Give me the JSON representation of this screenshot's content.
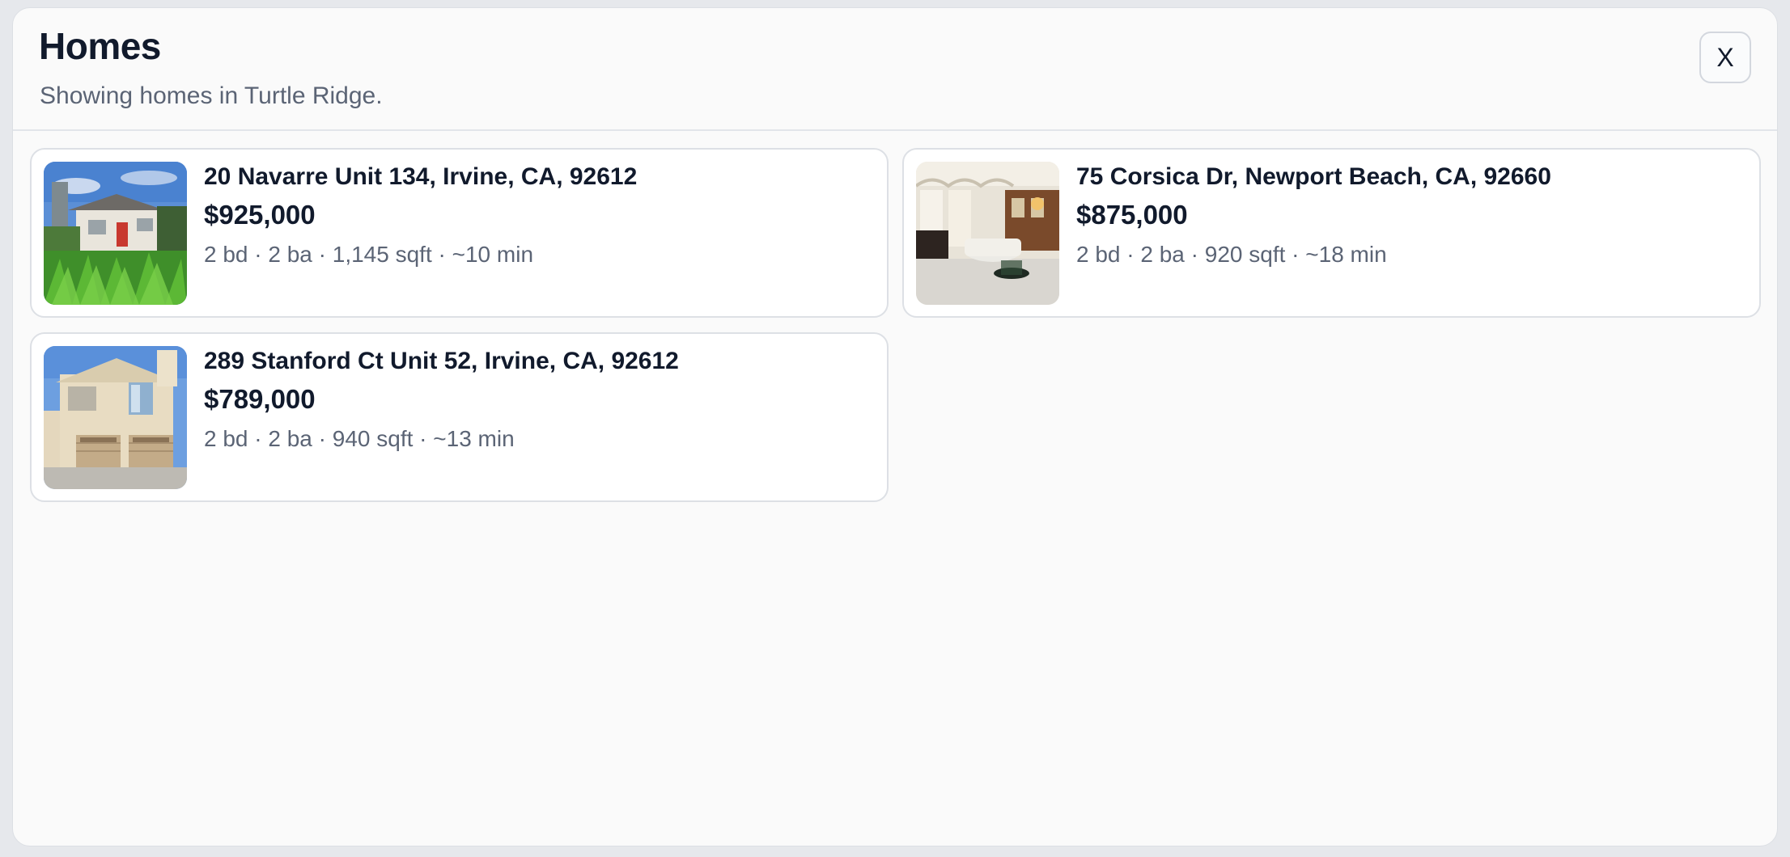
{
  "header": {
    "title": "Homes",
    "subtitle": "Showing homes in Turtle Ridge.",
    "close_label": "X"
  },
  "listings": [
    {
      "address": "20 Navarre Unit 134, Irvine, CA, 92612",
      "price": "$925,000",
      "details": "2 bd · 2 ba · 1,145 sqft · ~10 min",
      "photo_icon": "house-exterior-garden-photo"
    },
    {
      "address": "75 Corsica Dr, Newport Beach, CA, 92660",
      "price": "$875,000",
      "details": "2 bd · 2 ba · 920 sqft · ~18 min",
      "photo_icon": "living-room-interior-photo"
    },
    {
      "address": "289 Stanford Ct Unit 52, Irvine, CA, 92612",
      "price": "$789,000",
      "details": "2 bd · 2 ba · 940 sqft · ~13 min",
      "photo_icon": "townhouse-garage-photo"
    }
  ]
}
